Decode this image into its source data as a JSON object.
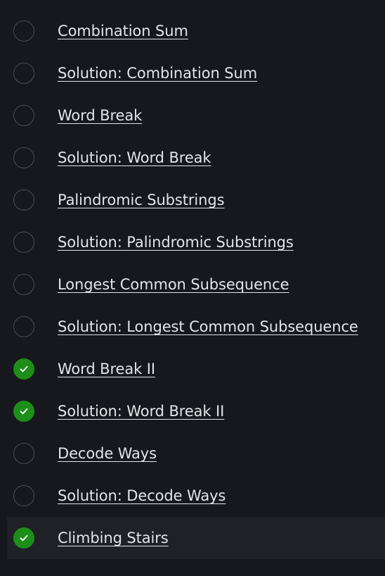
{
  "lessons": [
    {
      "title": "Combination Sum",
      "completed": false
    },
    {
      "title": "Solution: Combination Sum",
      "completed": false
    },
    {
      "title": "Word Break",
      "completed": false
    },
    {
      "title": "Solution: Word Break",
      "completed": false
    },
    {
      "title": "Palindromic Substrings",
      "completed": false
    },
    {
      "title": "Solution: Palindromic Substrings",
      "completed": false
    },
    {
      "title": "Longest Common Subsequence",
      "completed": false
    },
    {
      "title": "Solution: Longest Common Subsequence",
      "completed": false
    },
    {
      "title": "Word Break II",
      "completed": true
    },
    {
      "title": "Solution: Word Break II",
      "completed": true
    },
    {
      "title": "Decode Ways",
      "completed": false
    },
    {
      "title": "Solution: Decode Ways",
      "completed": false
    },
    {
      "title": "Climbing Stairs",
      "completed": true,
      "active": true
    }
  ],
  "colors": {
    "background": "#17181d",
    "active_row": "#1f2127",
    "completed": "#1e8e1a",
    "incomplete_border": "#4a4d56",
    "text": "#e3e4e8"
  },
  "icons": {
    "completed": "check-circle-icon",
    "incomplete": "empty-circle-icon"
  }
}
